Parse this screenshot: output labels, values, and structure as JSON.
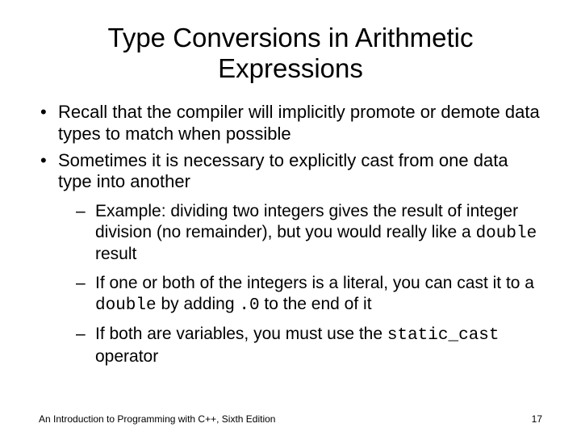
{
  "title": "Type Conversions in Arithmetic Expressions",
  "bullets": {
    "b1": "Recall that the compiler will implicitly promote or demote data types to match when possible",
    "b2": "Sometimes it is necessary to explicitly cast from one data type into another"
  },
  "subs": {
    "s1a": "Example: dividing two integers gives the result of integer division (no remainder), but you would really like a ",
    "s1code": "double",
    "s1b": " result",
    "s2a": "If one or both of the integers is a literal, you can cast it to a ",
    "s2code": "double",
    "s2b": " by adding ",
    "s2code2": ".0",
    "s2c": " to the end of it",
    "s3a": "If both are variables, you must use the ",
    "s3code": "static_cast",
    "s3b": " operator"
  },
  "footer": {
    "left": "An Introduction to Programming with C++, Sixth Edition",
    "right": "17"
  }
}
